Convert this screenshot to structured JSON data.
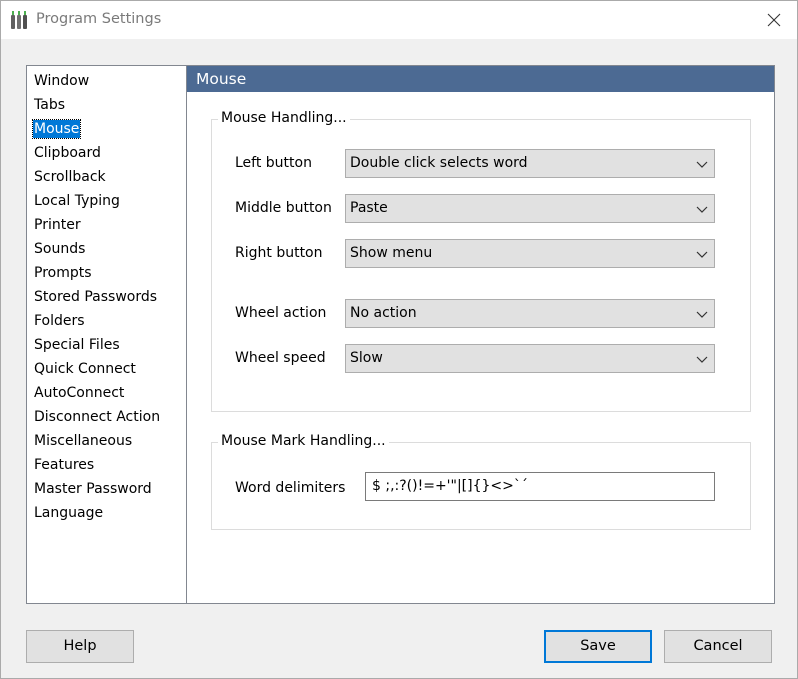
{
  "window": {
    "title": "Program Settings"
  },
  "sidebar": {
    "items": [
      {
        "label": "Window"
      },
      {
        "label": "Tabs"
      },
      {
        "label": "Mouse",
        "selected": true
      },
      {
        "label": "Clipboard"
      },
      {
        "label": "Scrollback"
      },
      {
        "label": "Local Typing"
      },
      {
        "label": "Printer"
      },
      {
        "label": "Sounds"
      },
      {
        "label": "Prompts"
      },
      {
        "label": "Stored Passwords"
      },
      {
        "label": "Folders"
      },
      {
        "label": "Special Files"
      },
      {
        "label": "Quick Connect"
      },
      {
        "label": "AutoConnect"
      },
      {
        "label": "Disconnect Action"
      },
      {
        "label": "Miscellaneous"
      },
      {
        "label": "Features"
      },
      {
        "label": "Master Password"
      },
      {
        "label": "Language"
      }
    ]
  },
  "panel": {
    "title": "Mouse",
    "mouse_handling": {
      "title": "Mouse Handling...",
      "left_button": {
        "label": "Left button",
        "value": "Double click selects word"
      },
      "middle_button": {
        "label": "Middle button",
        "value": "Paste"
      },
      "right_button": {
        "label": "Right button",
        "value": "Show menu"
      },
      "wheel_action": {
        "label": "Wheel action",
        "value": "No action"
      },
      "wheel_speed": {
        "label": "Wheel speed",
        "value": "Slow"
      }
    },
    "mouse_mark": {
      "title": "Mouse Mark Handling...",
      "word_delimiters": {
        "label": "Word delimiters",
        "value": "$ ;,:?()!=+'\"|[]{}<>`´"
      }
    }
  },
  "buttons": {
    "help": "Help",
    "save": "Save",
    "cancel": "Cancel"
  },
  "colors": {
    "accent": "#0078d7",
    "panel_header": "#4c6a93"
  }
}
